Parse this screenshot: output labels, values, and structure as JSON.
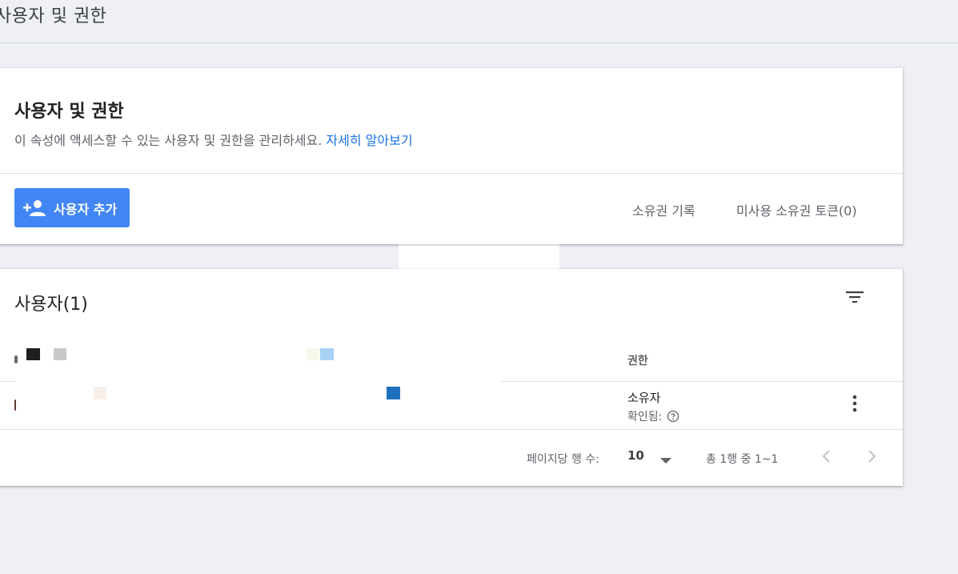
{
  "header": {
    "title": "사용자 및 권한"
  },
  "overview_card": {
    "title": "사용자 및 권한",
    "description": "이 속성에 액세스할 수 있는 사용자 및 권한을 관리하세요. ",
    "learn_more": "자세히 알아보기",
    "add_user_label": "사용자 추가",
    "ownership_history_label": "소유권 기록",
    "unused_tokens_label": "미사용 소유권 토큰(0)"
  },
  "users_card": {
    "title": "사용자(1)",
    "columns": {
      "role": "권한"
    },
    "rows": [
      {
        "role": "소유자",
        "status": "확인됨:"
      }
    ],
    "footer": {
      "rows_per_page_label": "페이지당 행 수:",
      "rows_per_page_value": "10",
      "range_text": "총 1행 중 1~1"
    }
  },
  "colors": {
    "accent": "#4285f4",
    "link": "#1a73e8",
    "background": "#eef0f6"
  },
  "icons": [
    "person-add-icon",
    "filter-icon",
    "help-icon",
    "more-vert-icon",
    "chevron-left-icon",
    "chevron-right-icon",
    "dropdown-caret-icon"
  ]
}
